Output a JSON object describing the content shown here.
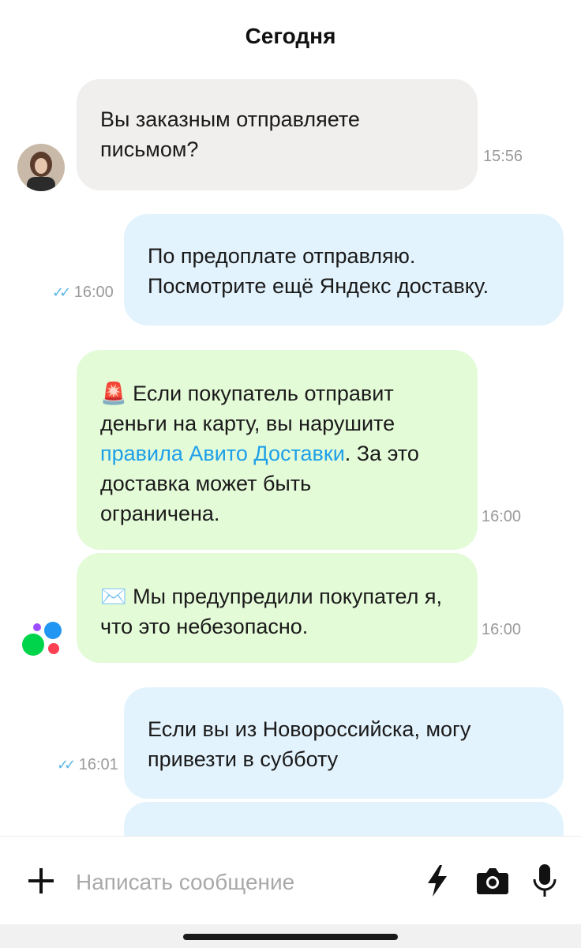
{
  "chat": {
    "date_header": "Сегодня",
    "messages": [
      {
        "text": "Вы заказным отправляете письмом?",
        "time": "15:56"
      },
      {
        "line1": "По предоплате отправляю.",
        "line2": "Посмотрите ещё Яндекс доставку.",
        "time": "16:00"
      },
      {
        "emoji": "🚨",
        "before_link": "Если покупатель отправит деньги на карту, вы нарушите ",
        "link": "правила Авито Доставки",
        "after_link": ". За это доставка может быть ограничена.",
        "time": "16:00"
      },
      {
        "emoji": "✉️",
        "text": "Мы предупредили покупател я, что это небезопасно.",
        "time": "16:00"
      },
      {
        "line1": "Если вы из Новороссийска, могу",
        "line2": "привезти в субботу",
        "time": "16:01"
      }
    ]
  },
  "composer": {
    "placeholder": "Написать сообщение",
    "icons": {
      "add": "plus-icon",
      "quick_reply": "lightning-icon",
      "camera": "camera-icon",
      "voice": "microphone-icon"
    }
  },
  "colors": {
    "incoming_bubble": "#f0efed",
    "outgoing_bubble": "#e3f3fd",
    "system_bubble": "#e4fbd8",
    "link": "#1ea0e8",
    "read_checks": "#59b5e6"
  }
}
